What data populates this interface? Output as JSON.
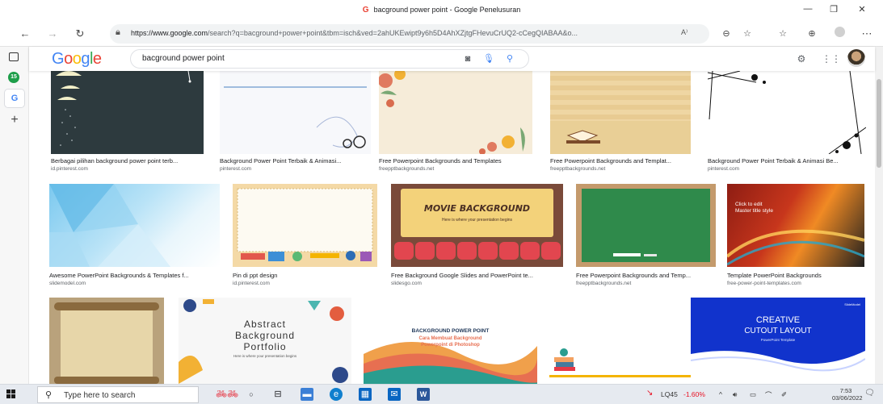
{
  "window": {
    "title": "bacground power point - Google Penelusuran",
    "favicon_letter": "G"
  },
  "browser": {
    "url_host": "https://www.google.com",
    "url_rest": "/search?q=bacground+power+point&tbm=isch&ved=2ahUKEwipt9y6h5D4AhXZjtgFHevuCrUQ2-cCegQIABAA&o...",
    "sidebar_badge": "15",
    "sidebar_tab_letter": "G"
  },
  "google": {
    "logo": [
      "G",
      "o",
      "o",
      "g",
      "l",
      "e"
    ],
    "query": "bacground power point"
  },
  "results": [
    {
      "caption": "Berbagai pilihan background power point terb...",
      "source": "id.pinterest.com"
    },
    {
      "caption": "Background Power Point Terbaik & Animasi...",
      "source": "pinterest.com"
    },
    {
      "caption": "Free Powerpoint Backgrounds and Templates",
      "source": "freepptbackgrounds.net"
    },
    {
      "caption": "Free Powerpoint Backgrounds and Templat...",
      "source": "freepptbackgrounds.net"
    },
    {
      "caption": "Background Power Point Terbaik & Animasi Be...",
      "source": "pinterest.com"
    },
    {
      "caption": "Awesome PowerPoint Backgrounds & Templates f...",
      "source": "slidemodel.com"
    },
    {
      "caption": "Pin di ppt design",
      "source": "id.pinterest.com"
    },
    {
      "caption": "Free Background Google Slides and PowerPoint te...",
      "source": "slidesgo.com"
    },
    {
      "caption": "Free Powerpoint Backgrounds and Temp...",
      "source": "freepptbackgrounds.net"
    },
    {
      "caption": "Template PowerPoint Backgrounds",
      "source": "free-power-point-templates.com"
    },
    {
      "caption": "",
      "source": ""
    },
    {
      "caption": "",
      "source": ""
    },
    {
      "caption": "",
      "source": ""
    },
    {
      "caption": "",
      "source": ""
    },
    {
      "caption": "",
      "source": ""
    }
  ],
  "thumb_text": {
    "movie_title": "MOVIE BACKGROUND",
    "movie_sub": "Here is where your presentation begins",
    "click_edit": "Click to edit",
    "master_title": "Master title style",
    "abstract_1": "Abstract",
    "abstract_2": "Background",
    "abstract_3": "Portfolio",
    "abstract_sub": "Here is where your presentation begins",
    "bgpp_title": "BACKGROUND POWER POINT",
    "bgpp_sub1": "Cara Membuat Background",
    "bgpp_sub2": "Powerpoint di Photoshop",
    "creative_1": "CREATIVE",
    "creative_2": "CUTOUT LAYOUT",
    "creative_3": "PowerPoint Template",
    "slidemodel": "SlideModel"
  },
  "taskbar": {
    "search_placeholder": "Type here to search",
    "stock_name": "LQ45",
    "stock_change": "-1.60%",
    "time": "7:53",
    "date": "03/06/2022"
  },
  "colors": {
    "stock_down": "#e81123",
    "google_blue": "#4285f4",
    "google_red": "#ea4335",
    "google_yellow": "#fbbc05",
    "google_green": "#34a853"
  }
}
